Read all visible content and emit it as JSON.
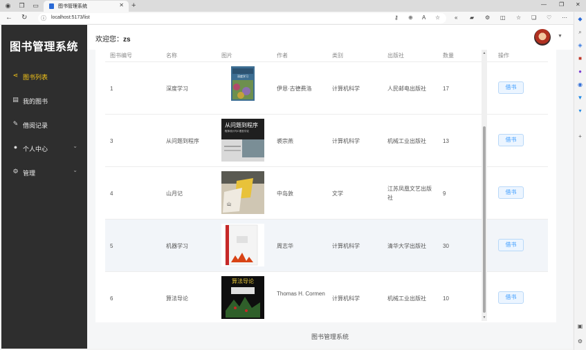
{
  "browser": {
    "tab_title": "图书管理系统",
    "url": "localhost:5173/list"
  },
  "sidebar": {
    "logo": "图书管理系统",
    "items": [
      {
        "label": "图书列表",
        "icon": "share-icon",
        "active": true
      },
      {
        "label": "我的图书",
        "icon": "clipboard-icon",
        "active": false
      },
      {
        "label": "借阅记录",
        "icon": "edit-icon",
        "active": false
      },
      {
        "label": "个人中心",
        "icon": "user-icon",
        "active": false,
        "expandable": true
      },
      {
        "label": "管理",
        "icon": "gear-icon",
        "active": false,
        "expandable": true
      }
    ]
  },
  "header": {
    "welcome_prefix": "欢迎您：",
    "username": "zs"
  },
  "table": {
    "columns": [
      "图书编号",
      "名称",
      "图片",
      "作者",
      "类别",
      "出版社",
      "数量",
      "操作"
    ],
    "rows": [
      {
        "id": "1",
        "name": "深度学习",
        "author": "伊恩·古德费洛",
        "category": "计算机科学",
        "publisher": "人民邮电出版社",
        "count": "17",
        "action": "借书"
      },
      {
        "id": "3",
        "name": "从问题到程序",
        "author": "裘宗燕",
        "category": "计算机科学",
        "publisher": "机械工业出版社",
        "count": "13",
        "action": "借书"
      },
      {
        "id": "4",
        "name": "山月记",
        "author": "中岛敦",
        "category": "文学",
        "publisher": "江苏凤凰文艺出版社",
        "count": "9",
        "action": "借书"
      },
      {
        "id": "5",
        "name": "机器学习",
        "author": "周志华",
        "category": "计算机科学",
        "publisher": "清华大学出版社",
        "count": "30",
        "action": "借书"
      },
      {
        "id": "6",
        "name": "算法导论",
        "author": "Thomas H. Cormen",
        "category": "计算机科学",
        "publisher": "机械工业出版社",
        "count": "10",
        "action": "借书"
      }
    ],
    "covers": {
      "row1": "深度学习",
      "row2": "从问题到程序",
      "row2_sub": "程序设计与C语言引论",
      "row5": "算法导论"
    }
  },
  "footer": {
    "text": "图书管理系统"
  },
  "colors": {
    "sidebar_bg": "#2e2e2e",
    "active": "#f5c518",
    "button": "#409eff"
  }
}
